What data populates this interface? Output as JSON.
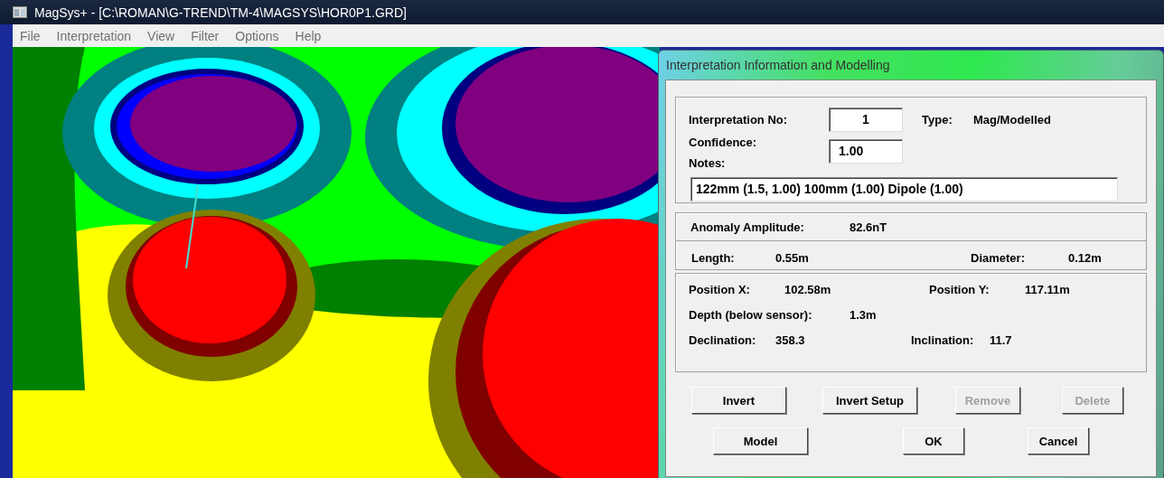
{
  "window": {
    "title": "MagSys+ - [C:\\ROMAN\\G-TREND\\TM-4\\MAGSYS\\HOR0P1.GRD]"
  },
  "menu": [
    "File",
    "Interpretation",
    "View",
    "Filter",
    "Options",
    "Help"
  ],
  "dialog": {
    "title": "Interpretation Information and Modelling",
    "interpretation_no": {
      "label": "Interpretation No:",
      "value": "1"
    },
    "type": {
      "label": "Type:",
      "value": "Mag/Modelled"
    },
    "confidence": {
      "label": "Confidence:",
      "value": "1.00"
    },
    "notes": {
      "label": "Notes:",
      "value": "122mm (1.5, 1.00) 100mm (1.00) Dipole (1.00)"
    },
    "amplitude": {
      "label": "Anomaly Amplitude:",
      "value": "82.6nT"
    },
    "length": {
      "label": "Length:",
      "value": "0.55m"
    },
    "diameter": {
      "label": "Diameter:",
      "value": "0.12m"
    },
    "position_x": {
      "label": "Position X:",
      "value": "102.58m"
    },
    "position_y": {
      "label": "Position Y:",
      "value": "117.11m"
    },
    "depth": {
      "label": "Depth (below sensor):",
      "value": "1.3m"
    },
    "declination": {
      "label": "Declination:",
      "value": "358.3"
    },
    "inclination": {
      "label": "Inclination:",
      "value": "11.7"
    },
    "button_rows": [
      [
        {
          "label": "Invert",
          "disabled": false
        },
        {
          "label": "Invert Setup",
          "disabled": false
        },
        {
          "label": "Remove",
          "disabled": true
        },
        {
          "label": "Delete",
          "disabled": true
        }
      ],
      [
        {
          "label": "Model",
          "disabled": false
        },
        {
          "label": "OK",
          "disabled": false
        },
        {
          "label": "Cancel",
          "disabled": false
        }
      ]
    ]
  }
}
